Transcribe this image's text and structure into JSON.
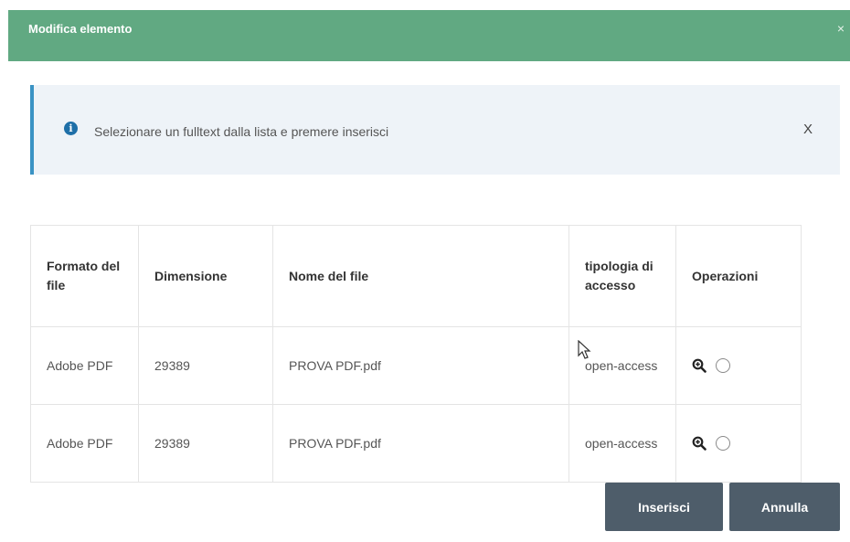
{
  "modal": {
    "title": "Modifica elemento",
    "close": "×"
  },
  "alert": {
    "text": "Selezionare un fulltext dalla lista e premere inserisci",
    "close": "X",
    "icon": "info-icon"
  },
  "table": {
    "headers": [
      "Formato del file",
      "Dimensione",
      "Nome del file",
      "tipologia di accesso",
      "Operazioni"
    ],
    "rows": [
      {
        "format": "Adobe PDF",
        "size": "29389",
        "name": "PROVA PDF.pdf",
        "access": "open-access"
      },
      {
        "format": "Adobe PDF",
        "size": "29389",
        "name": "PROVA PDF.pdf",
        "access": "open-access"
      }
    ]
  },
  "buttons": {
    "insert": "Inserisci",
    "cancel": "Annulla"
  },
  "colors": {
    "header": "#61a982",
    "alert_border": "#3a93c4",
    "button": "#4e5d6a"
  }
}
